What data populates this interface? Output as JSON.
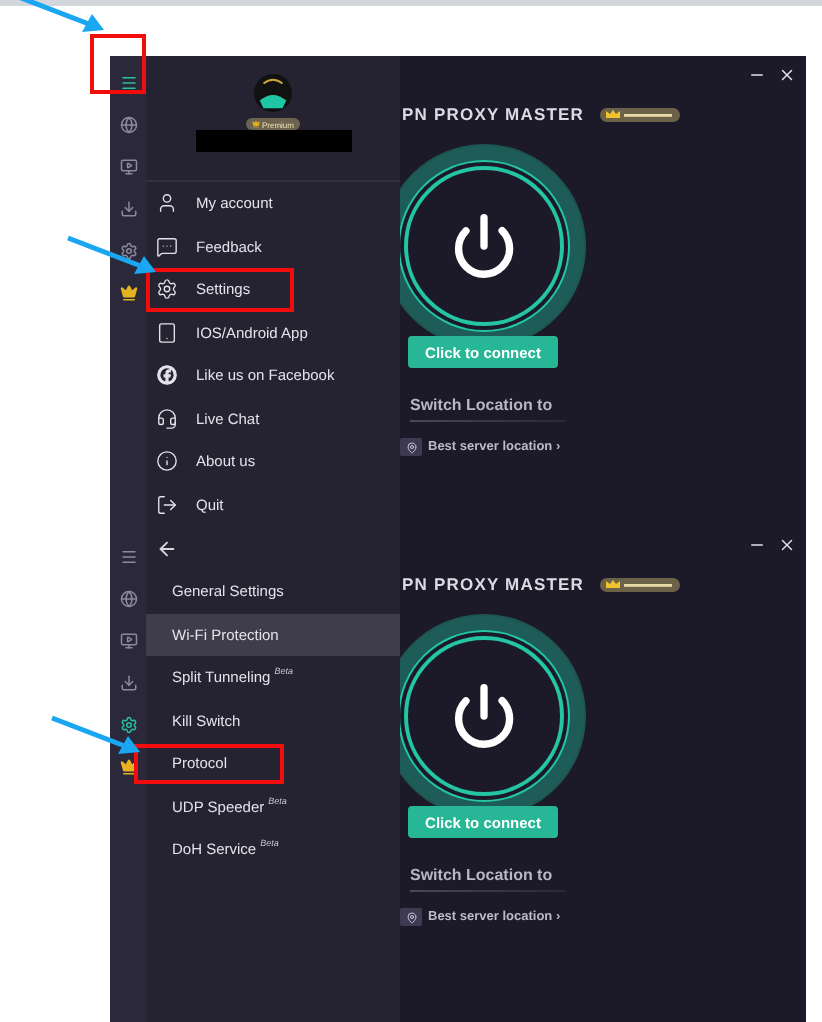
{
  "screens": [
    {
      "kind": "menu",
      "sidebar": [
        {
          "selected": true,
          "highlighted": true
        },
        {
          "selected": false,
          "highlighted": false
        },
        {
          "selected": false,
          "highlighted": false
        },
        {
          "selected": false,
          "highlighted": false
        },
        {
          "selected": false,
          "highlighted": false
        },
        {
          "selected": false,
          "highlighted": false
        }
      ],
      "profile": {
        "badge": "Premium"
      },
      "menu": [
        {
          "label": "My account",
          "highlighted": false
        },
        {
          "label": "Feedback",
          "highlighted": false
        },
        {
          "label": "Settings",
          "highlighted": true
        },
        {
          "label": "IOS/Android App",
          "highlighted": false
        },
        {
          "label": "Like us on Facebook",
          "highlighted": false
        },
        {
          "label": "Live Chat",
          "highlighted": false
        },
        {
          "label": "About us",
          "highlighted": false
        },
        {
          "label": "Quit",
          "highlighted": false
        }
      ],
      "main": {
        "title": "PN PROXY MASTER",
        "connect_button": "Click to connect",
        "switch_label": "Switch Location to",
        "location": "Best server location",
        "chevron": "›"
      }
    },
    {
      "kind": "settings",
      "sidebar": [
        {
          "selected": false,
          "highlighted": false
        },
        {
          "selected": false,
          "highlighted": false
        },
        {
          "selected": false,
          "highlighted": false
        },
        {
          "selected": false,
          "highlighted": false
        },
        {
          "selected": true,
          "highlighted": false
        },
        {
          "selected": false,
          "highlighted": false
        }
      ],
      "menu": [
        {
          "label": "General Settings",
          "selected": false,
          "highlighted": false
        },
        {
          "label": "Wi-Fi Protection",
          "selected": true,
          "highlighted": false
        },
        {
          "label": "Split Tunneling",
          "tag": "Beta",
          "selected": false,
          "highlighted": false
        },
        {
          "label": "Kill Switch",
          "selected": false,
          "highlighted": false
        },
        {
          "label": "Protocol",
          "selected": false,
          "highlighted": true
        },
        {
          "label": "UDP Speeder",
          "tag": "Beta",
          "selected": false,
          "highlighted": false
        },
        {
          "label": "DoH Service",
          "tag": "Beta",
          "selected": false,
          "highlighted": false
        }
      ],
      "main": {
        "title": "PN PROXY MASTER",
        "connect_button": "Click to connect",
        "switch_label": "Switch Location to",
        "location": "Best server location",
        "chevron": "›"
      }
    }
  ]
}
